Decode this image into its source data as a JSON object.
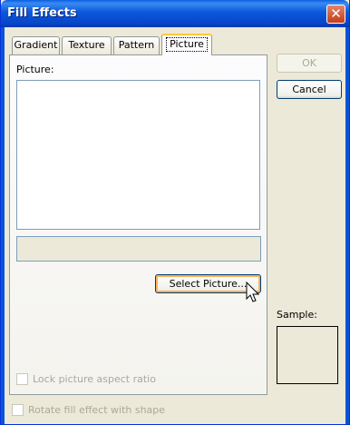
{
  "window": {
    "title": "Fill Effects",
    "close_symbol": "✕",
    "close_icon": "close-icon"
  },
  "tabs": [
    {
      "label": "Gradient",
      "active": false
    },
    {
      "label": "Texture",
      "active": false
    },
    {
      "label": "Pattern",
      "active": false
    },
    {
      "label": "Picture",
      "active": true
    }
  ],
  "picture_panel": {
    "label": "Picture:",
    "select_button": "Select Picture...",
    "lock_aspect_label": "Lock picture aspect ratio"
  },
  "rotate_label": "Rotate fill effect with shape",
  "buttons": {
    "ok": "OK",
    "cancel": "Cancel"
  },
  "sample_label": "Sample:",
  "colors": {
    "titlebar": "#0a58dc",
    "face": "#ece9d8",
    "focus_ring": "#f9b25a",
    "active_tab_accent": "#ffc73c"
  },
  "cursor_icon": "arrow-pointer-icon"
}
